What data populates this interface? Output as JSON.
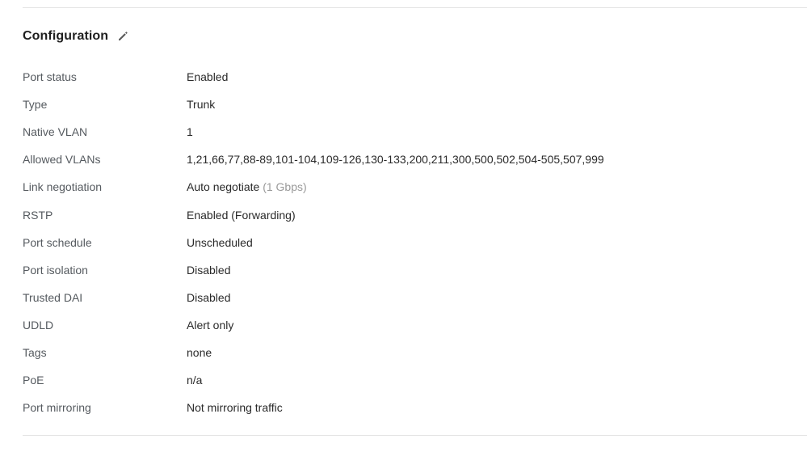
{
  "config": {
    "title": "Configuration",
    "edit_icon": "pencil-icon",
    "rows": [
      {
        "label": "Port status",
        "value": "Enabled"
      },
      {
        "label": "Type",
        "value": "Trunk"
      },
      {
        "label": "Native VLAN",
        "value": "1"
      },
      {
        "label": "Allowed VLANs",
        "value": "1,21,66,77,88-89,101-104,109-126,130-133,200,211,300,500,502,504-505,507,999"
      },
      {
        "label": "Link negotiation",
        "value": "Auto negotiate",
        "note": "(1 Gbps)"
      },
      {
        "label": "RSTP",
        "value": "Enabled (Forwarding)"
      },
      {
        "label": "Port schedule",
        "value": "Unscheduled"
      },
      {
        "label": "Port isolation",
        "value": "Disabled"
      },
      {
        "label": "Trusted DAI",
        "value": "Disabled"
      },
      {
        "label": "UDLD",
        "value": "Alert only"
      },
      {
        "label": "Tags",
        "value": "none"
      },
      {
        "label": "PoE",
        "value": "n/a"
      },
      {
        "label": "Port mirroring",
        "value": "Not mirroring traffic"
      }
    ]
  },
  "colors": {
    "label": "#555a5f",
    "value": "#2a2a2a",
    "note": "#9a9a9a",
    "divider": "#e4e4e4"
  }
}
